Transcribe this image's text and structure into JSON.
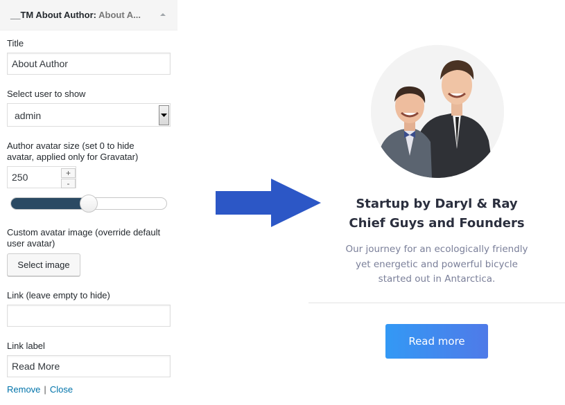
{
  "widget": {
    "title_prefix": "__TM About Author",
    "title_separator": ": ",
    "title_suffix": "About A...",
    "fields": {
      "title_label": "Title",
      "title_value": "About Author",
      "user_label": "Select user to show",
      "user_value": "admin",
      "avatar_size_label_line1": "Author avatar size (set 0 to hide",
      "avatar_size_label_line2": "avatar, applied only for Gravatar)",
      "avatar_size_value": "250",
      "spin_up": "+",
      "spin_down": "-",
      "avatar_size_slider_fraction": 0.5,
      "custom_avatar_label_line1": "Custom avatar image (override default",
      "custom_avatar_label_line2": "user avatar)",
      "select_image_button": "Select image",
      "link_label": "Link (leave empty to hide)",
      "link_value": "",
      "link_text_label": "Link label",
      "link_text_value": "Read More"
    },
    "footer": {
      "remove": "Remove",
      "separator": "|",
      "close": "Close"
    }
  },
  "preview": {
    "name_line1": "Startup by Daryl & Ray",
    "name_line2": "Chief Guys and Founders",
    "description_line1": "Our journey for an ecologically friendly",
    "description_line2": "yet energetic and powerful bicycle",
    "description_line3": "started out in Antarctica.",
    "button_label": "Read more"
  },
  "colors": {
    "arrow": "#2c57c6",
    "slider_fill": "#2b4a63",
    "link": "#0073aa",
    "button_gradient_start": "#3399f5",
    "button_gradient_end": "#4f7ae8",
    "heading": "#2b2f3e",
    "description": "#7a7f99"
  },
  "icons": {
    "panel_toggle": "triangle-up-icon",
    "select_dropdown": "chevron-down-icon",
    "arrow": "arrow-right-icon",
    "avatar": "avatar-photo"
  }
}
